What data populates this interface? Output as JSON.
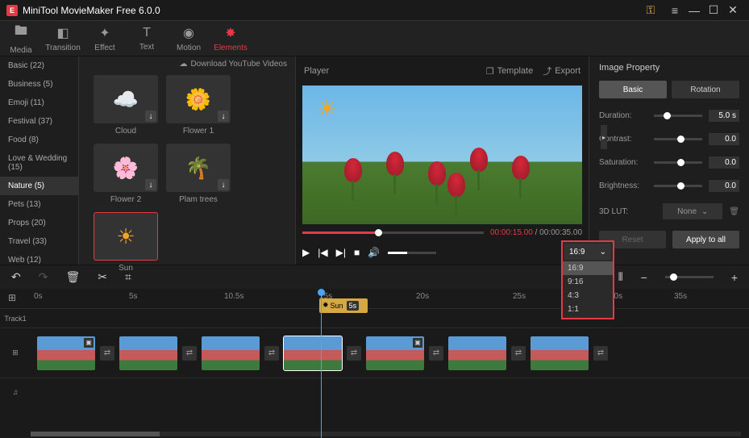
{
  "app": {
    "title": "MiniTool MovieMaker Free 6.0.0"
  },
  "toolbar": {
    "media": "Media",
    "transition": "Transition",
    "effect": "Effect",
    "text": "Text",
    "motion": "Motion",
    "elements": "Elements"
  },
  "sidebar": {
    "items": [
      "Basic (22)",
      "Business (5)",
      "Emoji (11)",
      "Festival (37)",
      "Food (8)",
      "Love & Wedding (15)",
      "Nature (5)",
      "Pets (13)",
      "Props (20)",
      "Travel (33)",
      "Web (12)"
    ]
  },
  "content": {
    "download_link": "Download YouTube Videos",
    "elements": [
      {
        "label": "Cloud"
      },
      {
        "label": "Flower 1"
      },
      {
        "label": "Flower 2"
      },
      {
        "label": "Plam trees"
      },
      {
        "label": "Sun"
      }
    ]
  },
  "player": {
    "title": "Player",
    "template": "Template",
    "export": "Export",
    "current_time": "00:00:15.00",
    "total_time": "00:00:35.00",
    "aspect_selected": "16:9",
    "aspect_options": [
      "16:9",
      "9:16",
      "4:3",
      "1:1"
    ]
  },
  "props": {
    "title": "Image Property",
    "tab_basic": "Basic",
    "tab_rotation": "Rotation",
    "duration_label": "Duration:",
    "duration_val": "5.0 s",
    "contrast_label": "Contrast:",
    "contrast_val": "0.0",
    "saturation_label": "Saturation:",
    "saturation_val": "0.0",
    "brightness_label": "Brightness:",
    "brightness_val": "0.0",
    "lut_label": "3D LUT:",
    "lut_val": "None",
    "reset": "Reset",
    "apply": "Apply to all"
  },
  "timeline": {
    "track_label": "Track1",
    "ticks": [
      "0s",
      "5s",
      "10.5s",
      "15s",
      "20s",
      "25s",
      "30s",
      "35s"
    ],
    "overlay_name": "Sun",
    "overlay_dur": "5s"
  }
}
